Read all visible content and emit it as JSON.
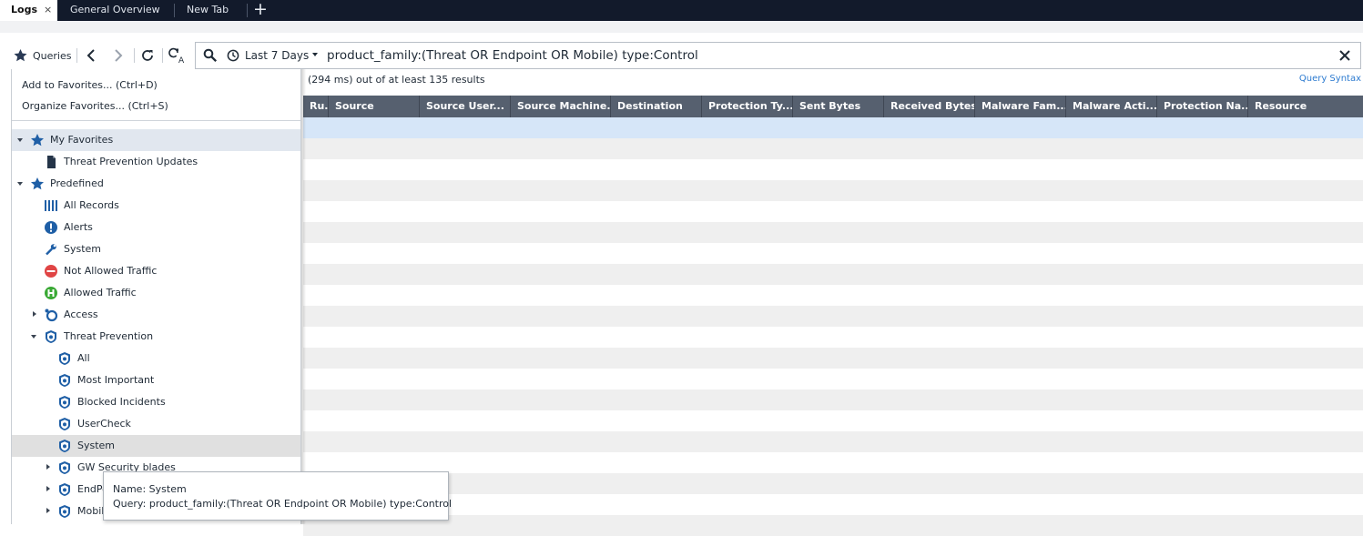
{
  "tabs": [
    {
      "label": "Logs",
      "active": true
    },
    {
      "label": "General Overview",
      "active": false
    },
    {
      "label": "New Tab",
      "active": false
    }
  ],
  "tab_close_glyph": "×",
  "tab_add_glyph": "+",
  "toolbar": {
    "queries_label": "Queries",
    "icons": [
      "star-icon",
      "back-icon",
      "forward-icon",
      "refresh-icon",
      "query-format-icon"
    ]
  },
  "search": {
    "time_range": "Last 7 Days",
    "query": "product_family:(Threat OR Endpoint OR Mobile) type:Control"
  },
  "results_text": "(294 ms) out of at least 135 results",
  "query_syntax_link": "Query Syntax",
  "grid": {
    "columns": [
      "Ru...",
      "Source",
      "Source User...",
      "Source Machine...",
      "Destination",
      "Protection Ty...",
      "Sent Bytes",
      "Received Bytes",
      "Malware Fam...",
      "Malware Acti...",
      "Protection Na...",
      "Resource"
    ]
  },
  "menu": {
    "add_favorites": "Add to Favorites... (Ctrl+D)",
    "organize_favorites": "Organize Favorites...  (Ctrl+S)"
  },
  "tree": [
    {
      "label": "My Favorites",
      "icon": "star-icon",
      "expander": "expanded"
    },
    {
      "label": "Threat Prevention Updates",
      "icon": "document-icon",
      "expander": "none"
    },
    {
      "label": "Predefined",
      "icon": "star-icon",
      "expander": "expanded"
    },
    {
      "label": "All Records",
      "icon": "records-icon",
      "expander": "none"
    },
    {
      "label": "Alerts",
      "icon": "alert-icon",
      "expander": "none"
    },
    {
      "label": "System",
      "icon": "wrench-icon",
      "expander": "none"
    },
    {
      "label": "Not Allowed Traffic",
      "icon": "blocked-icon",
      "expander": "none"
    },
    {
      "label": "Allowed Traffic",
      "icon": "allowed-icon",
      "expander": "none"
    },
    {
      "label": "Access",
      "icon": "access-icon",
      "expander": "collapsed"
    },
    {
      "label": "Threat Prevention",
      "icon": "shield-icon",
      "expander": "expanded"
    },
    {
      "label": "All",
      "icon": "shield-icon",
      "expander": "none"
    },
    {
      "label": "Most Important",
      "icon": "shield-icon",
      "expander": "none"
    },
    {
      "label": "Blocked Incidents",
      "icon": "shield-icon",
      "expander": "none"
    },
    {
      "label": "UserCheck",
      "icon": "shield-icon",
      "expander": "none"
    },
    {
      "label": "System",
      "icon": "shield-icon",
      "expander": "none"
    },
    {
      "label": "GW Security blades",
      "icon": "shield-icon",
      "expander": "collapsed"
    },
    {
      "label": "EndPoint",
      "icon": "shield-icon",
      "expander": "collapsed"
    },
    {
      "label": "Mobile",
      "icon": "shield-icon",
      "expander": "collapsed"
    }
  ],
  "tooltip": {
    "name_line": "Name: System",
    "query_line": "Query: product_family:(Threat OR Endpoint OR Mobile) type:Control"
  },
  "colors": {
    "tabbar": "#121a2b",
    "grid_header": "#56606f",
    "selected_row": "#d6e6f8",
    "alt_row": "#efefef",
    "icon_blue": "#1f5fa6",
    "alert_red": "#e04545",
    "allowed_green": "#3aa935"
  }
}
